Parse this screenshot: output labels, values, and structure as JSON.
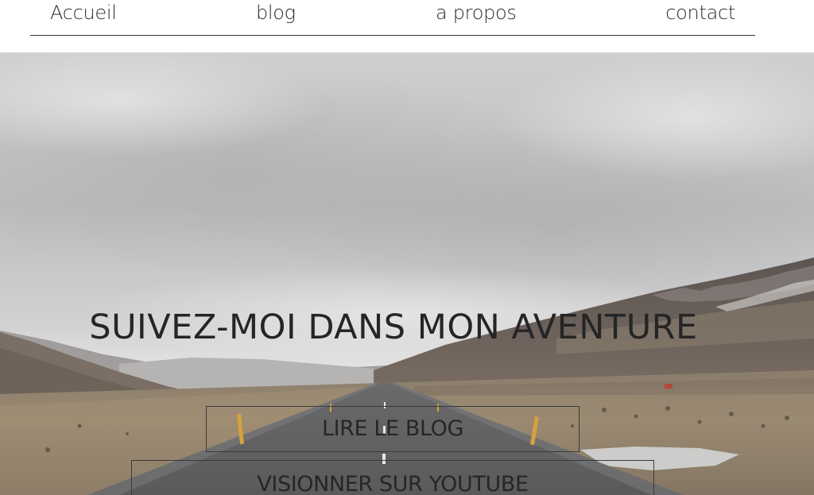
{
  "nav": {
    "items": [
      {
        "label": "Accueil"
      },
      {
        "label": "blog"
      },
      {
        "label": "a propos"
      },
      {
        "label": "contact"
      }
    ]
  },
  "hero": {
    "headline": "SUIVEZ-MOI DANS MON AVENTURE",
    "buttons": {
      "read_blog": "LIRE LE BLOG",
      "watch_youtube": "VISIONNER SUR YOUTUBE"
    }
  }
}
